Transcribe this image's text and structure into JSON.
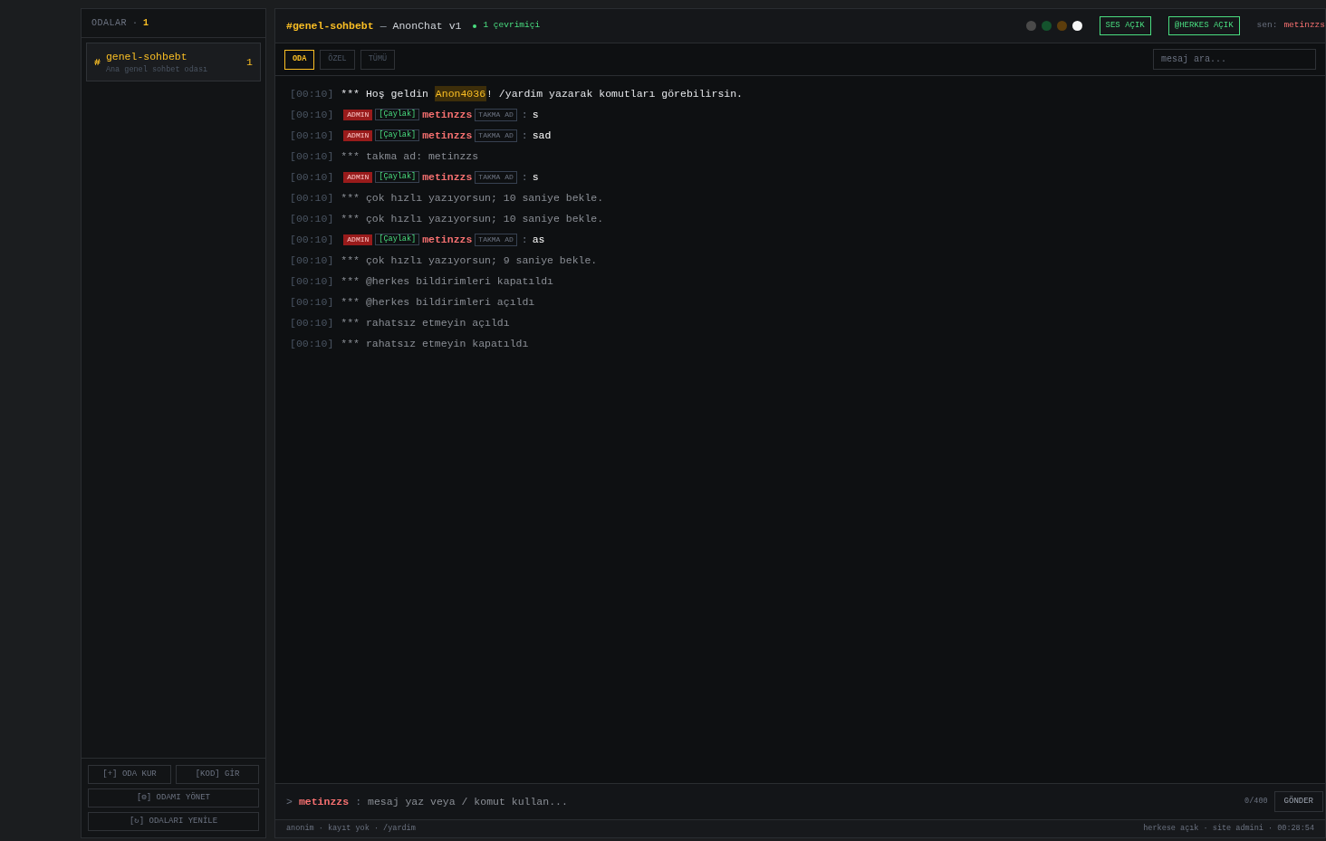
{
  "sidebar": {
    "title": "ODALAR",
    "separator": "·",
    "count": "1",
    "rooms": [
      {
        "icon": "#",
        "name": "genel-sohbebt",
        "description": "Ana genel sohbet odası",
        "count": "1",
        "selected": true
      }
    ],
    "action_rows": [
      {
        "buttons": [
          "[+] ODA KUR",
          "[KOD] GİR"
        ]
      },
      {
        "buttons": [
          "[⚙] ODAMI YÖNET"
        ]
      },
      {
        "buttons": [
          "[↻] ODALARI YENİLE"
        ]
      }
    ]
  },
  "header": {
    "channel": "#genel-sohbebt",
    "dash": "—",
    "app": "AnonChat v1",
    "online": "1 çevrimiçi",
    "dots": [
      {
        "color": "#4a4a4a"
      },
      {
        "color": "#14532d"
      },
      {
        "color": "#5c3d0c"
      },
      {
        "color": "#f5f5f5"
      }
    ],
    "toggles": [
      {
        "label": "SES AÇIK",
        "on": true
      },
      {
        "label": "@HERKES AÇIK",
        "on": true
      }
    ],
    "me_label": "sen:",
    "me_name": "metinzzs"
  },
  "tabs": [
    {
      "label": "ODA",
      "selected": true
    },
    {
      "label": "ÖZEL",
      "selected": false
    },
    {
      "label": "TÜMÜ",
      "selected": false
    }
  ],
  "search": {
    "placeholder": "mesaj ara..."
  },
  "messages": [
    {
      "kind": "welcome",
      "time": "[00:10]",
      "prefix": "*** Hoş geldin",
      "name": "Anon4036",
      "suffix": "! /yardim yazarak komutları görebilirsin."
    },
    {
      "kind": "user",
      "time": "[00:10]",
      "role": "ADMIN",
      "rank": "[Çaylak]",
      "nick": "metinzzs",
      "tag": "TAKMA AD",
      "sep": ":",
      "text": "s"
    },
    {
      "kind": "user",
      "time": "[00:10]",
      "role": "ADMIN",
      "rank": "[Çaylak]",
      "nick": "metinzzs",
      "tag": "TAKMA AD",
      "sep": ":",
      "text": "sad"
    },
    {
      "kind": "system",
      "time": "[00:10]",
      "text": "*** takma ad: metinzzs"
    },
    {
      "kind": "user",
      "time": "[00:10]",
      "role": "ADMIN",
      "rank": "[Çaylak]",
      "nick": "metinzzs",
      "tag": "TAKMA AD",
      "sep": ":",
      "text": "s"
    },
    {
      "kind": "system",
      "time": "[00:10]",
      "text": "*** çok hızlı yazıyorsun; 10 saniye bekle."
    },
    {
      "kind": "system",
      "time": "[00:10]",
      "text": "*** çok hızlı yazıyorsun; 10 saniye bekle."
    },
    {
      "kind": "user",
      "time": "[00:10]",
      "role": "ADMIN",
      "rank": "[Çaylak]",
      "nick": "metinzzs",
      "tag": "TAKMA AD",
      "sep": ":",
      "text": "as"
    },
    {
      "kind": "system",
      "time": "[00:10]",
      "text": "*** çok hızlı yazıyorsun; 9 saniye bekle."
    },
    {
      "kind": "system",
      "time": "[00:10]",
      "text": "*** @herkes bildirimleri kapatıldı"
    },
    {
      "kind": "system",
      "time": "[00:10]",
      "text": "*** @herkes bildirimleri açıldı"
    },
    {
      "kind": "system",
      "time": "[00:10]",
      "text": "*** rahatsız etmeyin açıldı"
    },
    {
      "kind": "system",
      "time": "[00:10]",
      "text": "*** rahatsız etmeyin kapatıldı"
    }
  ],
  "composer": {
    "prompt": ">",
    "nick": "metinzzs",
    "sep": ":",
    "placeholder": "mesaj yaz veya / komut kullan...",
    "counter": "0/400",
    "send": "GÖNDER"
  },
  "status_bar": {
    "left": "anonim · kayıt yok · /yardim",
    "right": "herkese açık · site admini · 00:28:54"
  }
}
